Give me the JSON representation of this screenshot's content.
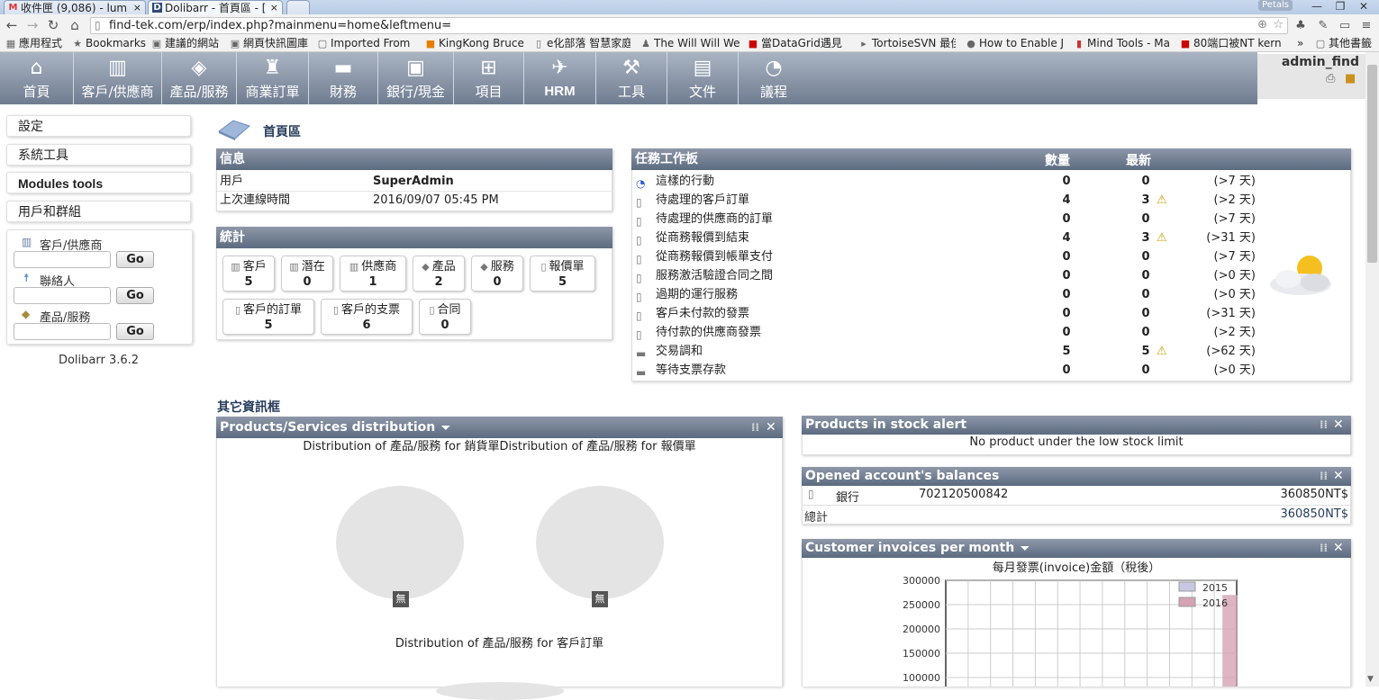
{
  "browser": {
    "tabs": [
      {
        "label": "收件匣 (9,086) - lum",
        "icon": "M"
      },
      {
        "label": "Dolibarr - 首頁區 - [",
        "icon": "D"
      }
    ],
    "url": "find-tek.com/erp/index.php?mainmenu=home&leftmenu=",
    "petals_label": "Petals",
    "bookmarks": [
      "應用程式",
      "Bookmarks",
      "建議的網站",
      "網頁快訊圖庫",
      "Imported From I",
      "KingKong Bruce",
      "e化部落 智慧家庭",
      "The Will Will We",
      "當DataGrid遇見",
      "TortoiseSVN 最佳",
      "How to Enable J",
      "Mind Tools - Ma",
      "80端口被NT kern",
      "其他書籤"
    ]
  },
  "topmenu": {
    "items": [
      "首頁",
      "客戶/供應商",
      "產品/服務",
      "商業訂單",
      "財務",
      "銀行/現金",
      "項目",
      "HRM",
      "工具",
      "文件",
      "議程"
    ],
    "user": "admin_find"
  },
  "leftmenu": {
    "buttons": [
      "設定",
      "系統工具",
      "Modules tools",
      "用戶和群組"
    ],
    "search": [
      {
        "label": "客戶/供應商",
        "go": "Go"
      },
      {
        "label": "聯絡人",
        "go": "Go"
      },
      {
        "label": "產品/服務",
        "go": "Go"
      }
    ],
    "version": "Dolibarr 3.6.2"
  },
  "main": {
    "title": "首頁區",
    "info": {
      "header": "信息",
      "rows": [
        {
          "label": "用戶",
          "value": "SuperAdmin"
        },
        {
          "label": "上次連線時間",
          "value": "2016/09/07 05:45 PM"
        }
      ]
    },
    "stats": {
      "header": "統計",
      "items": [
        {
          "label": "客戶",
          "count": "5"
        },
        {
          "label": "潛在",
          "count": "0"
        },
        {
          "label": "供應商",
          "count": "1"
        },
        {
          "label": "產品",
          "count": "2"
        },
        {
          "label": "服務",
          "count": "0"
        },
        {
          "label": "報價單",
          "count": "5"
        },
        {
          "label": "客戶的訂單",
          "count": "5"
        },
        {
          "label": "客戶的支票",
          "count": "6"
        },
        {
          "label": "合同",
          "count": "0"
        }
      ]
    },
    "tasks": {
      "header": "任務工作板",
      "col_count": "數量",
      "col_latest": "最新",
      "rows": [
        {
          "label": "這樣的行動",
          "count": "0",
          "latest": "0",
          "warn": false,
          "delay": "(>7 天)"
        },
        {
          "label": "待處理的客戶訂單",
          "count": "4",
          "latest": "3",
          "warn": true,
          "delay": "(>2 天)"
        },
        {
          "label": "待處理的供應商的訂單",
          "count": "0",
          "latest": "0",
          "warn": false,
          "delay": "(>7 天)"
        },
        {
          "label": "從商務報價到結束",
          "count": "4",
          "latest": "3",
          "warn": true,
          "delay": "(>31 天)"
        },
        {
          "label": "從商務報價到帳單支付",
          "count": "0",
          "latest": "0",
          "warn": false,
          "delay": "(>7 天)"
        },
        {
          "label": "服務激活驗證合同之間",
          "count": "0",
          "latest": "0",
          "warn": false,
          "delay": "(>0 天)"
        },
        {
          "label": "過期的運行服務",
          "count": "0",
          "latest": "0",
          "warn": false,
          "delay": "(>0 天)"
        },
        {
          "label": "客戶未付款的發票",
          "count": "0",
          "latest": "0",
          "warn": false,
          "delay": "(>31 天)"
        },
        {
          "label": "待付款的供應商發票",
          "count": "0",
          "latest": "0",
          "warn": false,
          "delay": "(>2 天)"
        },
        {
          "label": "交易調和",
          "count": "5",
          "latest": "5",
          "warn": true,
          "delay": "(>62 天)"
        },
        {
          "label": "等待支票存款",
          "count": "0",
          "latest": "0",
          "warn": false,
          "delay": "(>0 天)"
        }
      ]
    },
    "other_info": "其它資訊框"
  },
  "widgets": {
    "products_distribution": {
      "title": "Products/Services distribution",
      "subtitle1": "Distribution of 產品/服務 for 銷貨單Distribution of 產品/服務 for 報價單",
      "subtitle2": "Distribution of 產品/服務 for 客戶訂單",
      "no_data": "無"
    },
    "stock_alert": {
      "title": "Products in stock alert",
      "message": "No product under the low stock limit"
    },
    "balances": {
      "title": "Opened account's balances",
      "bank": "銀行",
      "account": "702120500842",
      "amount": "360850NT$",
      "total_label": "總計",
      "total_amount": "360850NT$"
    },
    "invoices": {
      "title": "Customer invoices per month",
      "chart_title": "每月發票(invoice)金額（稅後）"
    }
  },
  "chart_data": {
    "type": "bar",
    "title": "每月發票(invoice)金額（稅後）",
    "ylim": [
      100000,
      300000
    ],
    "yticks": [
      "300000",
      "250000",
      "200000",
      "150000",
      "100000"
    ],
    "grid": true,
    "legend_position": "top-right",
    "series": [
      {
        "name": "2015",
        "color": "#c8c8e6",
        "values": []
      },
      {
        "name": "2016",
        "color": "#d4a3b4",
        "values": [
          270000
        ]
      }
    ]
  },
  "colors": {
    "accent": "#263c5c",
    "menu": "#6f7c90",
    "warn": "#e6c000"
  }
}
